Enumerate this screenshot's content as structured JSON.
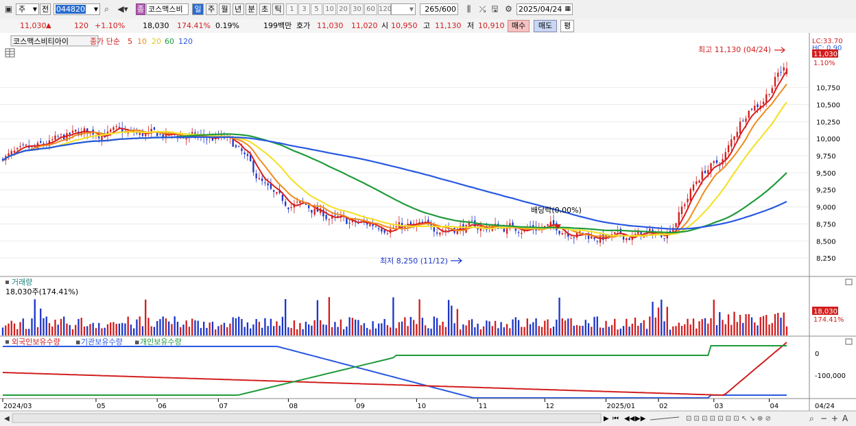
{
  "toolbar": {
    "market": "주",
    "range": "전",
    "code": "044820",
    "badge": "종",
    "name": "코스맥스비",
    "periods": [
      "일",
      "주",
      "월",
      "년",
      "분",
      "초",
      "틱"
    ],
    "intervals": [
      "1",
      "3",
      "5",
      "10",
      "20",
      "30",
      "60",
      "120"
    ],
    "count": "265",
    "count_total": "/600",
    "date": "2025/04/24"
  },
  "quote": {
    "price": "11,030",
    "arrow": "▲",
    "change": "120",
    "change_pct": "+1.10%",
    "volume": "18,030",
    "volume_pct": "174.41%",
    "turnover": "0.19%",
    "amount": "199백만",
    "bid_label": "호가",
    "ask": "11,030",
    "bid": "11,020",
    "open_label": "시",
    "open": "10,950",
    "high_label": "고",
    "high": "11,130",
    "low_label": "저",
    "low": "10,910",
    "buy_label": "매수",
    "sell_label": "매도",
    "eval_label": "평"
  },
  "price_pane": {
    "title": "코스맥스비티아이",
    "ma_label": "종가 단순",
    "ma_periods": [
      "5",
      "10",
      "20",
      "60",
      "120"
    ],
    "lc": "LC:33.70",
    "hc": "HC: 0.90",
    "price_tag": "11,030",
    "pct_tag": "1.10%",
    "high_note": "최고 11,130 (04/24)",
    "low_note": "최저 8,250 (11/12)",
    "dividend_note": "배당락(0.00%)",
    "yticks": [
      "10,750",
      "10,500",
      "10,250",
      "10,000",
      "9,750",
      "9,500",
      "9,250",
      "9,000",
      "8,750",
      "8,500",
      "8,250"
    ]
  },
  "volume_pane": {
    "title": "거래량",
    "value": "18,030주(174.41%)",
    "tag": "18,030",
    "pct_tag": "174.41%"
  },
  "holdings_pane": {
    "legend": [
      "외국인보유수량",
      "기관보유수량",
      "개인보유수량"
    ],
    "yticks": [
      "0",
      "-100,000"
    ]
  },
  "x_axis": {
    "labels": [
      "2024/03",
      "05",
      "06",
      "07",
      "08",
      "09",
      "10",
      "11",
      "12",
      "2025/01",
      "02",
      "03",
      "04"
    ],
    "right_label": "04/24"
  },
  "chart_data": {
    "type": "line",
    "title": "코스맥스비티아이",
    "anchors": [
      {
        "x": "2024/03",
        "close": 9750
      },
      {
        "x": "05",
        "close": 10100
      },
      {
        "x": "06",
        "close": 10050
      },
      {
        "x": "07",
        "close": 10000
      },
      {
        "x": "08",
        "close": 9050
      },
      {
        "x": "09",
        "close": 8750
      },
      {
        "x": "10",
        "close": 8700
      },
      {
        "x": "11",
        "close": 8700
      },
      {
        "x": "12",
        "close": 8700
      },
      {
        "x": "2025/01",
        "close": 8550
      },
      {
        "x": "02",
        "close": 8600
      },
      {
        "x": "03",
        "close": 9600
      },
      {
        "x": "04",
        "close": 10500
      },
      {
        "x": "04/24",
        "close": 11030
      }
    ],
    "series": [
      {
        "name": "5",
        "color": "#d81e1e"
      },
      {
        "name": "10",
        "color": "#f08a1c"
      },
      {
        "name": "20",
        "color": "#f5e12c"
      },
      {
        "name": "60",
        "color": "#1f9a3a"
      },
      {
        "name": "120",
        "color": "#2858e0"
      }
    ],
    "ylim": [
      8000,
      11350
    ]
  },
  "colors": {
    "up": "#d21d1d",
    "down": "#1c36c8",
    "ma5": "#d81e1e",
    "ma10": "#f08a1c",
    "ma20": "#f5e12c",
    "ma60": "#1f9a3a",
    "ma120": "#2858e0",
    "teal": "#19807f"
  }
}
